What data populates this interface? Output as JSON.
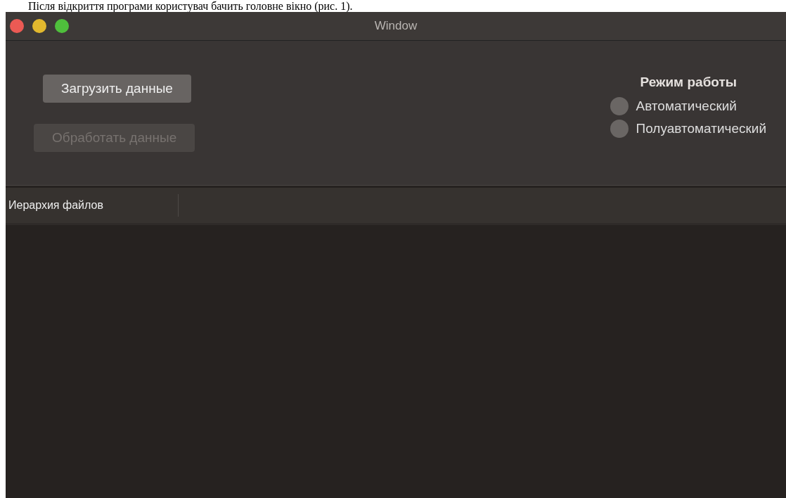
{
  "caption": "Після відкриття програми користувач бачить головне вікно (рис. 1).",
  "window": {
    "title": "Window"
  },
  "buttons": [
    {
      "label": "Загрузить данные",
      "disabled": false
    },
    {
      "label": "Обработать данные",
      "disabled": true
    }
  ],
  "mode": {
    "title": "Режим работы",
    "options": [
      {
        "label": "Автоматический",
        "selected": false
      },
      {
        "label": "Полуавтоматический",
        "selected": false
      }
    ]
  },
  "tree": {
    "columns": [
      "Иерархия файлов"
    ]
  }
}
